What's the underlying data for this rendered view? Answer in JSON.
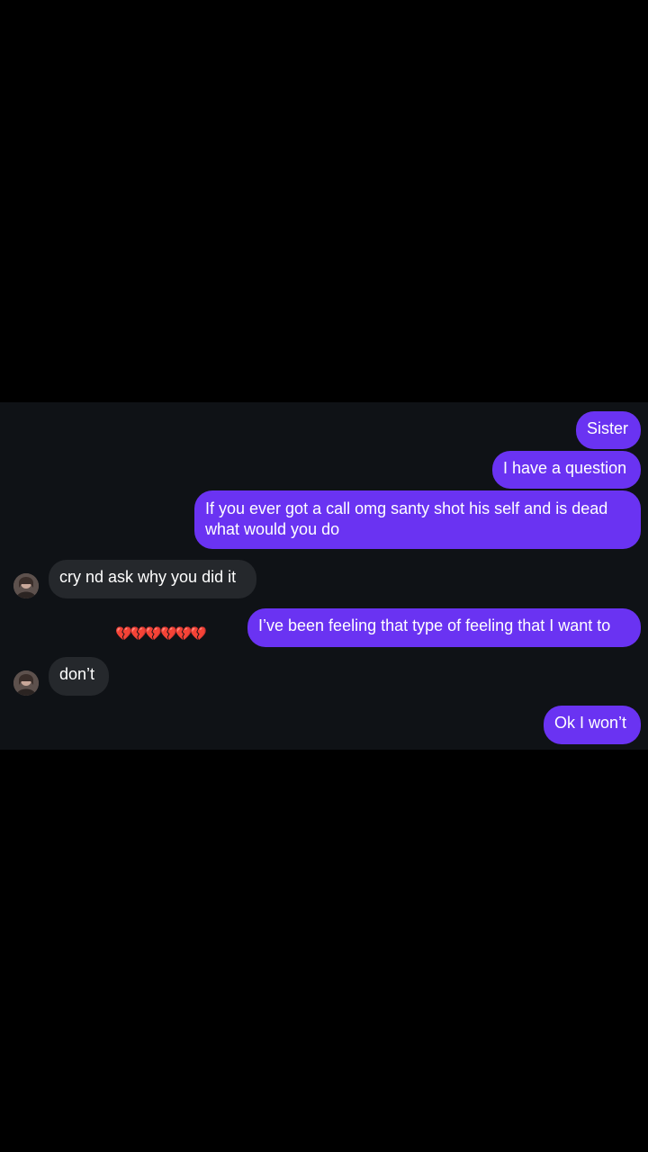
{
  "messages": [
    {
      "direction": "outgoing",
      "text": "Sister"
    },
    {
      "direction": "outgoing",
      "text": "I have a question"
    },
    {
      "direction": "outgoing",
      "text": "If you ever got a call omg santy shot his self and is dead what would you do"
    },
    {
      "direction": "incoming",
      "text": "cry nd ask why you did it"
    },
    {
      "direction": "outgoing",
      "text": "I’ve been feeling that type of feeling that I want to",
      "reactions": "💔💔💔💔💔💔"
    },
    {
      "direction": "incoming",
      "text": "don’t"
    },
    {
      "direction": "outgoing",
      "text": "Ok I won’t"
    }
  ],
  "colors": {
    "outgoing_bubble": "#6a33f2",
    "incoming_bubble": "#25282c",
    "chat_background": "#0f1216",
    "page_background": "#000000"
  },
  "icons": {
    "avatar": "contact-avatar-photo",
    "reaction": "broken-heart-emoji"
  }
}
